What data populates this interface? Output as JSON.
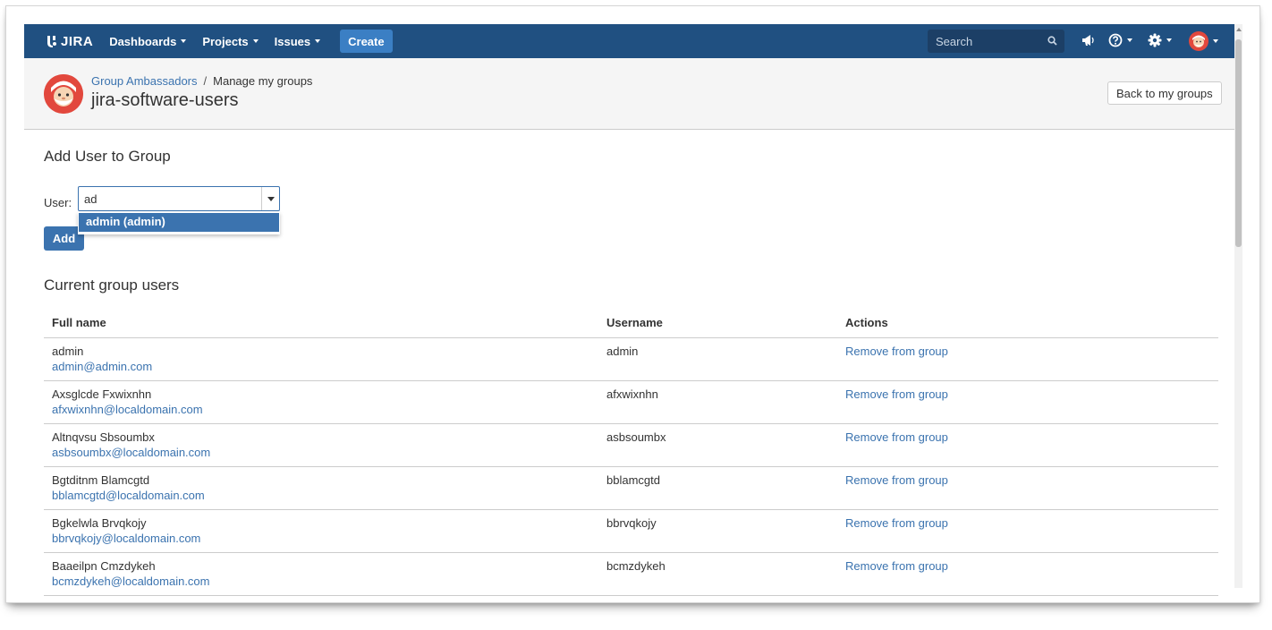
{
  "header": {
    "logo_text": "JIRA",
    "nav": [
      {
        "label": "Dashboards"
      },
      {
        "label": "Projects"
      },
      {
        "label": "Issues"
      }
    ],
    "create_label": "Create",
    "search_placeholder": "Search",
    "icons": [
      "notifications-megaphone-icon",
      "help-icon",
      "settings-gear-icon",
      "user-avatar-icon"
    ],
    "bar_color": "#205081",
    "accent_color": "#3b7fc4"
  },
  "page_header": {
    "breadcrumb_parent": "Group Ambassadors",
    "breadcrumb_separator": "/",
    "breadcrumb_current": "Manage my groups",
    "title": "jira-software-users",
    "back_button_label": "Back to my groups"
  },
  "add_user": {
    "section_title": "Add User to Group",
    "user_label": "User:",
    "input_value": "ad",
    "suggestion": "admin (admin)",
    "add_button_label": "Add"
  },
  "current_users": {
    "section_title": "Current group users",
    "columns": [
      "Full name",
      "Username",
      "Actions"
    ],
    "rows": [
      {
        "full_name": "admin",
        "email": "admin@admin.com",
        "username": "admin",
        "action": "Remove from group"
      },
      {
        "full_name": "Axsglcde Fxwixnhn",
        "email": "afxwixnhn@localdomain.com",
        "username": "afxwixnhn",
        "action": "Remove from group"
      },
      {
        "full_name": "Altnqvsu Sbsoumbx",
        "email": "asbsoumbx@localdomain.com",
        "username": "asbsoumbx",
        "action": "Remove from group"
      },
      {
        "full_name": "Bgtditnm Blamcgtd",
        "email": "bblamcgtd@localdomain.com",
        "username": "bblamcgtd",
        "action": "Remove from group"
      },
      {
        "full_name": "Bgkelwla Brvqkojy",
        "email": "bbrvqkojy@localdomain.com",
        "username": "bbrvqkojy",
        "action": "Remove from group"
      },
      {
        "full_name": "Baaeilpn Cmzdykeh",
        "email": "bcmzdykeh@localdomain.com",
        "username": "bcmzdykeh",
        "action": "Remove from group"
      }
    ]
  }
}
